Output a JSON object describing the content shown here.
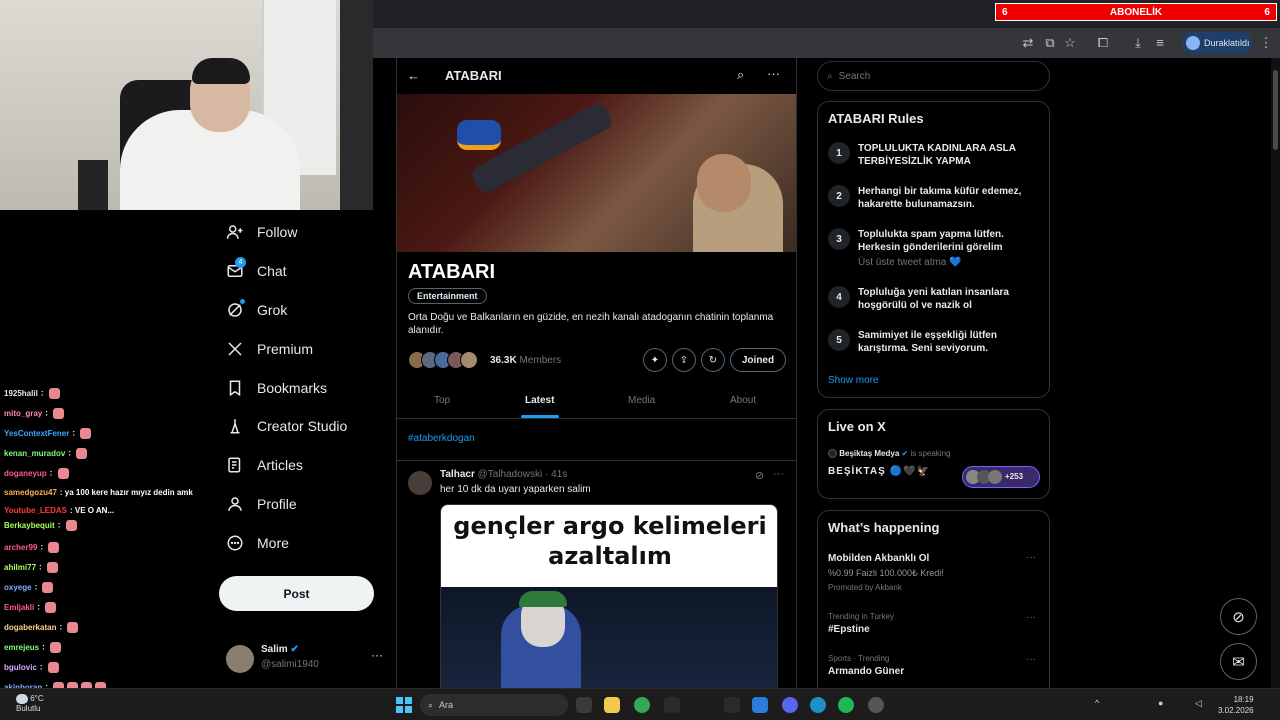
{
  "stream_overlay": {
    "sub_goal_left": "6",
    "sub_goal_label": "ABONELİK",
    "sub_goal_right": "6"
  },
  "browser": {
    "profile_label": "Duraklatıldı"
  },
  "chat": [
    {
      "user": "1925halil",
      "color": "#e7e9ea",
      "msg": ""
    },
    {
      "user": "mito_gray",
      "color": "#ff8aa0",
      "msg": ""
    },
    {
      "user": "YesContextFener",
      "color": "#3ea6ff",
      "msg": ""
    },
    {
      "user": "kenan_muradov",
      "color": "#7cfc7c",
      "msg": ""
    },
    {
      "user": "doganeyup",
      "color": "#ff5a8a",
      "msg": ""
    },
    {
      "user": "samedgozu47",
      "color": "#ffb347",
      "msg": "ya 100 kere hazır mıyız dedin amk"
    },
    {
      "user": "Youtube_LEDAS",
      "color": "#ff3b3b",
      "msg": "VE O AN..."
    },
    {
      "user": "Berkaybequit",
      "color": "#a7ff5a",
      "msg": ""
    },
    {
      "user": "archer99",
      "color": "#ff5a8a",
      "msg": ""
    },
    {
      "user": "ahilmi77",
      "color": "#a7ff5a",
      "msg": ""
    },
    {
      "user": "oxyege",
      "color": "#7fb0ff",
      "msg": ""
    },
    {
      "user": "Emljakli",
      "color": "#ff5a8a",
      "msg": ""
    },
    {
      "user": "dogaberkatan",
      "color": "#ffd28a",
      "msg": ""
    },
    {
      "user": "emrejeus",
      "color": "#7cfc7c",
      "msg": ""
    },
    {
      "user": "bgulovic",
      "color": "#d8a8ff",
      "msg": ""
    },
    {
      "user": "akinboran",
      "color": "#7fb0ff",
      "msg": ""
    }
  ],
  "nav": {
    "items": [
      {
        "label": "Follow",
        "icon": "follow-icon"
      },
      {
        "label": "Chat",
        "icon": "mail-icon",
        "badge": "4"
      },
      {
        "label": "Grok",
        "icon": "grok-icon"
      },
      {
        "label": "Premium",
        "icon": "x-logo-icon"
      },
      {
        "label": "Bookmarks",
        "icon": "bookmark-icon"
      },
      {
        "label": "Creator Studio",
        "icon": "creator-studio-icon"
      },
      {
        "label": "Articles",
        "icon": "articles-icon"
      },
      {
        "label": "Profile",
        "icon": "profile-icon"
      },
      {
        "label": "More",
        "icon": "more-icon"
      }
    ],
    "post_label": "Post"
  },
  "account": {
    "name": "Salim",
    "handle": "@salimi1940"
  },
  "community": {
    "header_title": "ATABARI",
    "name": "ATABARI",
    "category": "Entertainment",
    "description": "Orta Doğu ve Balkanların en güzide, en nezih kanalı atadoganın chatinin toplanma alanıdır.",
    "members_count": "36.3K",
    "members_label": "Members",
    "joined_label": "Joined",
    "tabs": [
      "Top",
      "Latest",
      "Media",
      "About"
    ],
    "active_tab": "Latest",
    "hashtag": "#ataberkdogan"
  },
  "tweet": {
    "name": "Talhacr",
    "handle": "@Talhadowski",
    "time": "41s",
    "text": "her 10 dk da uyarı yaparken salim",
    "meme_line1": "gençler argo kelimeleri",
    "meme_line2": "azaltalım"
  },
  "search": {
    "placeholder": "Search"
  },
  "rules": {
    "title": "ATABARI Rules",
    "items": [
      {
        "num": "1",
        "text": "TOPLULUKTA KADINLARA ASLA TERBİYESİZLİK YAPMA",
        "sub": ""
      },
      {
        "num": "2",
        "text": "Herhangi bir takıma küfür edemez, hakarette bulunamazsın.",
        "sub": ""
      },
      {
        "num": "3",
        "text": "Toplulukta spam yapma lütfen. Herkesin gönderilerini görelim",
        "sub": "Üst üste tweet atma 💙"
      },
      {
        "num": "4",
        "text": "Topluluğa yeni katılan insanlara hoşgörülü ol ve nazik ol",
        "sub": ""
      },
      {
        "num": "5",
        "text": "Samimiyet ile eşşekliği lütfen karıştırma. Seni seviyorum.",
        "sub": ""
      }
    ],
    "show_more": "Show more"
  },
  "live": {
    "title": "Live on X",
    "host": "Beşiktaş Medya",
    "status": "is speaking",
    "space_title": "BEŞİKTAŞ 🔵🖤🦅",
    "listeners": "+253"
  },
  "trends": {
    "title": "What’s happening",
    "items": [
      {
        "meta": "",
        "title": "Mobilden Akbanklı Ol",
        "sub": "%0.99 Faizli 100.000₺ Kredi!",
        "promo": "Promoted by Akbank"
      },
      {
        "meta": "Trending in Turkey",
        "title": "#Epstine"
      },
      {
        "meta": "Sports · Trending",
        "title": "Armando Güner"
      }
    ]
  },
  "taskbar": {
    "weather_temp": "6°C",
    "weather_desc": "Bulutlu",
    "search_placeholder": "Ara",
    "time": "18:19",
    "date": "3.02.2026"
  },
  "colors": {
    "accent": "#1d9bf0",
    "background": "#000000",
    "border": "#2f3336",
    "muted": "#71767b"
  }
}
